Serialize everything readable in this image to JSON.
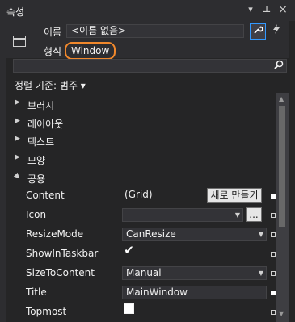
{
  "window": {
    "title": "속성"
  },
  "titlebar_buttons": {
    "pin": "▾",
    "pinned": "⊥",
    "close": "×"
  },
  "header": {
    "name_label": "이름",
    "name_value": "<이름 없음>",
    "type_label": "형식",
    "type_value": "Window",
    "properties_icon": "wrench-icon",
    "events_icon": "lightning-icon"
  },
  "search": {
    "placeholder": ""
  },
  "sort": {
    "label": "정렬 기준: 범주 ▾"
  },
  "categories": [
    {
      "name": "브러시",
      "expanded": false
    },
    {
      "name": "레이아웃",
      "expanded": false
    },
    {
      "name": "텍스트",
      "expanded": false
    },
    {
      "name": "모양",
      "expanded": false
    },
    {
      "name": "공용",
      "expanded": true
    }
  ],
  "properties": {
    "content": {
      "name": "Content",
      "value": "(Grid)",
      "button": "새로 만들기"
    },
    "icon": {
      "name": "Icon",
      "value": "",
      "button": "..."
    },
    "resize_mode": {
      "name": "ResizeMode",
      "value": "CanResize"
    },
    "show_in_taskbar": {
      "name": "ShowInTaskbar",
      "checked": true
    },
    "size_to_content": {
      "name": "SizeToContent",
      "value": "Manual"
    },
    "title": {
      "name": "Title",
      "value": "MainWindow"
    },
    "topmost": {
      "name": "Topmost",
      "checked": false
    }
  },
  "colors": {
    "accent": "#f0882c",
    "selected_border": "#3399ff",
    "background": "#252526"
  }
}
